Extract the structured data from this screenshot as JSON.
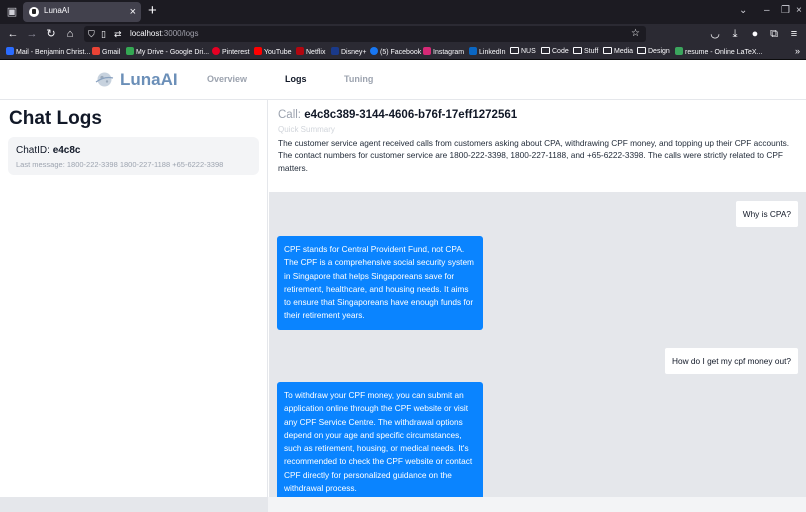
{
  "browser": {
    "tab_title": "LunaAI",
    "url_host": "localhost",
    "url_path": ":3000/logs",
    "bookmarks": [
      {
        "label": "Mail - Benjamin Christ...",
        "color": "#2b6cff"
      },
      {
        "label": "Gmail",
        "color": "#ea4335"
      },
      {
        "label": "My Drive - Google Dri...",
        "color": "#34a853"
      },
      {
        "label": "Pinterest",
        "color": "#e60023"
      },
      {
        "label": "YouTube",
        "color": "#ff0000"
      },
      {
        "label": "Netflix",
        "color": "#b20710"
      },
      {
        "label": "Disney+",
        "color": "#1a3a8a"
      },
      {
        "label": "(5) Facebook",
        "color": "#1877f2"
      },
      {
        "label": "Instagram",
        "color": "#d62976"
      },
      {
        "label": "LinkedIn",
        "color": "#0a66c2"
      }
    ],
    "folders": [
      "NUS",
      "Code",
      "Stuff",
      "Media",
      "Design"
    ],
    "last_bookmark": "resume - Online LaTeX..."
  },
  "app": {
    "brand": "LunaAI",
    "nav": {
      "overview": "Overview",
      "logs": "Logs",
      "tuning": "Tuning"
    },
    "active_nav": "logs",
    "accent_color": "#0a84ff"
  },
  "left": {
    "title": "Chat Logs",
    "chat": {
      "id_label": "ChatID:",
      "id_value": "e4c8c",
      "last_message": "Last message: 1800-222-3398 1800-227-1188 +65-6222-3398"
    }
  },
  "summary": {
    "call_label": "Call:",
    "call_id": "e4c8c389-3144-4606-b76f-17eff1272561",
    "quick_summary_label": "Quick Summary",
    "text": "The customer service agent received calls from customers asking about CPA, withdrawing CPF money, and topping up their CPF accounts. The contact numbers for customer service are 1800-222-3398, 1800-227-1188, and +65-6222-3398. The calls were strictly related to CPF matters."
  },
  "messages": [
    {
      "role": "user",
      "text": "Why is CPA?"
    },
    {
      "role": "bot",
      "text": "CPF stands for Central Provident Fund, not CPA. The CPF is a comprehensive social security system in Singapore that helps Singaporeans save for retirement, healthcare, and housing needs. It aims to ensure that Singaporeans have enough funds for their retirement years."
    },
    {
      "role": "user",
      "text": "How do I get my cpf money out?"
    },
    {
      "role": "bot",
      "text": "To withdraw your CPF money, you can submit an application online through the CPF website or visit any CPF Service Centre. The withdrawal options depend on your age and specific circumstances, such as retirement, housing, or medical needs. It's recommended to check the CPF website or contact CPF directly for personalized guidance on the withdrawal process."
    }
  ]
}
